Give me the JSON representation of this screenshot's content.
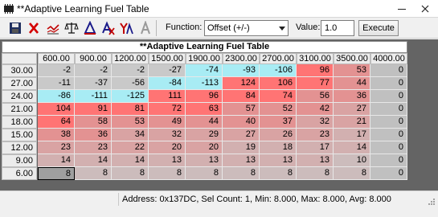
{
  "window": {
    "title": "**Adaptive Learning Fuel Table"
  },
  "toolbar": {
    "function_label": "Function:",
    "function_value": "Offset (+/-)",
    "value_label": "Value:",
    "value_input": "1.0",
    "execute_label": "Execute",
    "icons": [
      "save-icon",
      "delete-icon",
      "chart-icon",
      "balance-icon",
      "delta-a-icon",
      "x-a-icon",
      "y-a-icon",
      "font-a-icon"
    ]
  },
  "table": {
    "title": "**Adaptive Learning Fuel Table",
    "columns": [
      "600.00",
      "900.00",
      "1200.00",
      "1500.00",
      "1900.00",
      "2300.00",
      "2700.00",
      "3100.00",
      "3500.00",
      "4000.00"
    ],
    "rows": [
      "30.00",
      "27.00",
      "24.00",
      "21.00",
      "18.00",
      "15.00",
      "12.00",
      "9.00",
      "6.00"
    ],
    "cells": [
      [
        "-2",
        "-2",
        "-2",
        "-27",
        "-74",
        "-93",
        "-106",
        "96",
        "53",
        "0"
      ],
      [
        "-11",
        "-37",
        "-56",
        "-84",
        "-113",
        "124",
        "106",
        "77",
        "44",
        "0"
      ],
      [
        "-86",
        "-111",
        "-125",
        "111",
        "96",
        "84",
        "74",
        "56",
        "36",
        "0"
      ],
      [
        "104",
        "91",
        "81",
        "72",
        "63",
        "57",
        "52",
        "42",
        "27",
        "0"
      ],
      [
        "64",
        "58",
        "53",
        "49",
        "44",
        "40",
        "37",
        "32",
        "21",
        "0"
      ],
      [
        "38",
        "36",
        "34",
        "32",
        "29",
        "27",
        "26",
        "23",
        "17",
        "0"
      ],
      [
        "23",
        "23",
        "22",
        "20",
        "20",
        "19",
        "18",
        "17",
        "14",
        "0"
      ],
      [
        "14",
        "14",
        "14",
        "13",
        "13",
        "13",
        "13",
        "13",
        "10",
        "0"
      ],
      [
        "8",
        "8",
        "8",
        "8",
        "8",
        "8",
        "8",
        "8",
        "8",
        "0"
      ]
    ],
    "selected_cell": {
      "row": 8,
      "col": 0
    }
  },
  "status": {
    "text": "Address: 0x137DC, Sel Count: 1, Min: 8.000, Max: 8.000, Avg: 8.000"
  },
  "colors": {
    "negative_cyan": "#a8ecf4",
    "negative_gray": "#c9c9c9",
    "hot_red": "#ff7474",
    "grid_bg": "#646464",
    "selected_cell": "#9f9f9f"
  }
}
